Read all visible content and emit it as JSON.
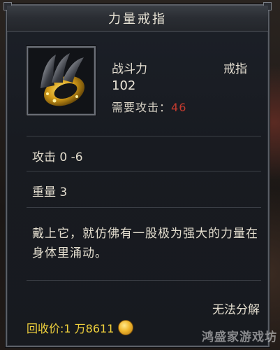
{
  "tooltip": {
    "title": "力量戒指",
    "item_type": "戒指",
    "combat_power_label": "战斗力",
    "combat_power_value": "102",
    "requirement_label": "需要攻击",
    "requirement_separator": "：",
    "requirement_value": "46",
    "attack_stat": "攻击 0 -6",
    "weight_stat": "重量 3",
    "description": "戴上它，就仿佛有一股极为强大的力量在身体里涌动。",
    "disassemble_status": "无法分解",
    "sell_label": "回收价:",
    "sell_value": "1 万8611",
    "item_icon": "ring-icon",
    "currency_icon": "gold-coin-icon"
  },
  "watermark": "鸿盛家游戏坊",
  "colors": {
    "requirement_value": "#c23a2e",
    "sell_price": "#f2d23c"
  }
}
